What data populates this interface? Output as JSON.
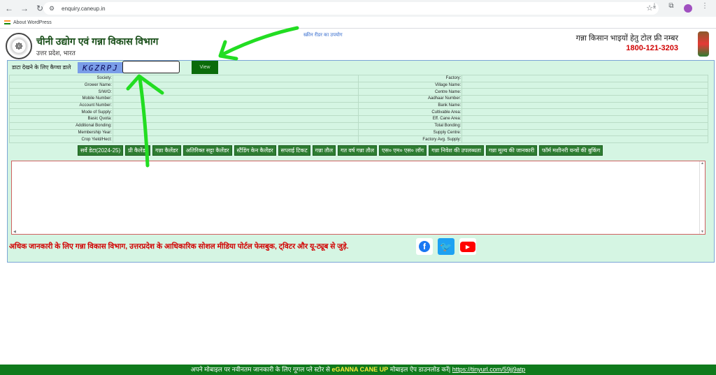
{
  "browser": {
    "url": "enquiry.caneup.in",
    "bookmark": "About WordPress"
  },
  "header": {
    "title": "चीनी उद्योग एवं गन्ना विकास विभाग",
    "subtitle": "उत्तर प्रदेश, भारत",
    "reader_link": "स्क्रीन रीडर का उपयोग",
    "tollfree_label": "गन्ना किसान भाइयों हेतु टोल फ्री नम्बर",
    "tollfree_number": "1800-121-3203"
  },
  "captcha": {
    "label": "डाटा देखने के लिए कैप्चा डाले",
    "code": "KGZRPJ",
    "input_value": "",
    "view_label": "View"
  },
  "info_rows": [
    {
      "l": "Society:",
      "r": "Factory:"
    },
    {
      "l": "Grower Name:",
      "r": "Village Name:"
    },
    {
      "l": "S/W/O:",
      "r": "Centre Name:"
    },
    {
      "l": "Mobile Number:",
      "r": "Aadhaar Number:"
    },
    {
      "l": "Account Number:",
      "r": "Bank Name:"
    },
    {
      "l": "Mode of Supply:",
      "r": "Cultivable Area:"
    },
    {
      "l": "Basic Quota:",
      "r": "Eff. Cane Area:"
    },
    {
      "l": "Additional Bonding:",
      "r": "Total Bonding:"
    },
    {
      "l": "Membership Year:",
      "r": "Supply Centre:"
    },
    {
      "l": "Crop Yield/Hect:",
      "r": "Factory Avg. Supply:"
    }
  ],
  "tabs": [
    "सर्वे डेटा(2024-25)",
    "प्री कैलेंडर",
    "गन्ना कैलेंडर",
    "अतिरिक्त सट्टा कैलेंडर",
    "स्टैंडिंग केन कैलेंडर",
    "सप्लाई टिकट",
    "गन्ना तौल",
    "गत वर्ष गन्ना तौल",
    "एस० एम० एस० लॉग",
    "गन्ना निवेश की उपलब्धता",
    "गन्ना मूल्य की जानकारी",
    "फॉर्म मशीनरी यन्त्रों की बुकिंग"
  ],
  "social": {
    "text": "अधिक जानकारी के लिए गन्ना विकास विभाग, उत्तरप्रदेश के आधिकारिक सोशल मीडिया पोर्टल फेसबुक, ट्विटर और यू-ट्यूब से जुड़े."
  },
  "footer": {
    "text_before": "अपने मोबाइल पर नवीनतम जानकारी के लिए गूगल प्ले स्टोर से",
    "app_name": "eGANNA CANE UP",
    "text_after": "मोबाइल ऐप डाउनलोड करें|",
    "link": "https://tinyurl.com/59jj9atp"
  },
  "colors": {
    "panel_bg": "#d5f5e3",
    "tab_green": "#2e7d32",
    "tollfree_red": "#d10000",
    "footer_green": "#0f7a1c",
    "annotation_green": "#22dd22"
  }
}
